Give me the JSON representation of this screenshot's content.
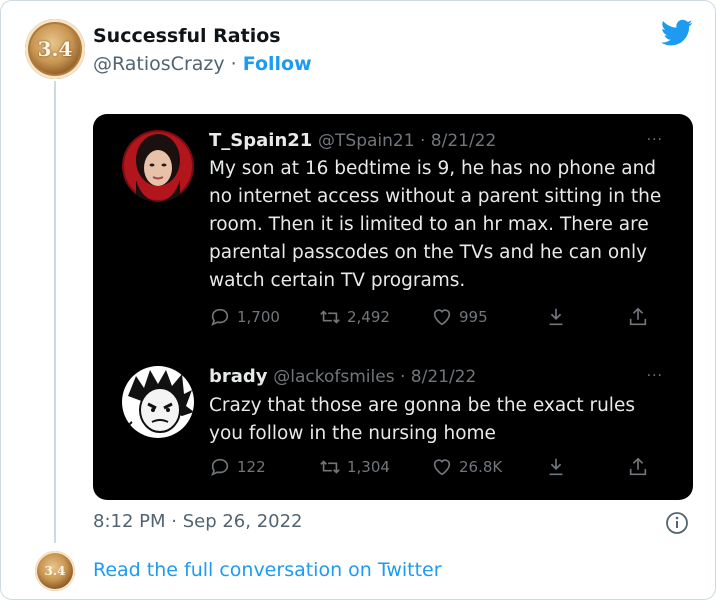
{
  "account": {
    "avatar_text": "3.4",
    "name": "Successful Ratios",
    "handle": "@RatiosCrazy",
    "separator": "·",
    "follow_label": "Follow"
  },
  "embedded": {
    "tweets": [
      {
        "name": "T_Spain21",
        "handle": "@TSpain21",
        "date": "8/21/22",
        "more": "···",
        "text": "My son at 16 bedtime is 9, he has no phone and no internet access without a parent sitting in the room. Then it is limited to an hr max. There are parental passcodes on the TVs and he can only watch certain TV programs.",
        "replies": "1,700",
        "retweets": "2,492",
        "likes": "995"
      },
      {
        "name": "brady",
        "handle": "@lackofsmiles",
        "date": "8/21/22",
        "more": "···",
        "text": "Crazy that those are gonna be the exact rules you follow in the nursing home",
        "replies": "122",
        "retweets": "1,304",
        "likes": "26.8K"
      }
    ]
  },
  "footer": {
    "timestamp": "8:12 PM · Sep 26, 2022",
    "read_more": "Read the full conversation on Twitter"
  },
  "icons": {
    "brand": "twitter-bird-icon",
    "brand_color": "#1d9bf0",
    "info": "info-icon",
    "reply": "reply-icon",
    "retweet": "retweet-icon",
    "like": "heart-icon",
    "download": "download-icon",
    "share": "share-icon"
  }
}
